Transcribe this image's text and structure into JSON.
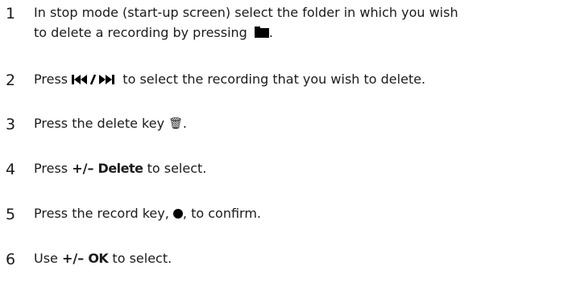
{
  "steps": [
    {
      "number": "1",
      "line1": "In stop mode (start-up screen) select the folder in which you wish",
      "line2_before": "to delete a recording by pressing ",
      "icon": "folder-icon",
      "line2_after": "."
    },
    {
      "number": "2",
      "before": "Press ",
      "keys": "I◀◀/▶▶I",
      "icon": "skip-back-forward-icon",
      "after": " to select the recording that you wish to delete."
    },
    {
      "number": "3",
      "before": "Press the delete key ",
      "icon_glyph": "🗑",
      "icon": "trash-icon",
      "after": "."
    },
    {
      "number": "4",
      "before": "Press ",
      "key": "+/–",
      "option": "Delete",
      "after": " to select."
    },
    {
      "number": "5",
      "before": "Press the record key, ",
      "icon": "record-dot-icon",
      "after": ", to confirm."
    },
    {
      "number": "6",
      "before": "Use ",
      "key": "+/–",
      "option": "OK",
      "after": " to select."
    }
  ]
}
